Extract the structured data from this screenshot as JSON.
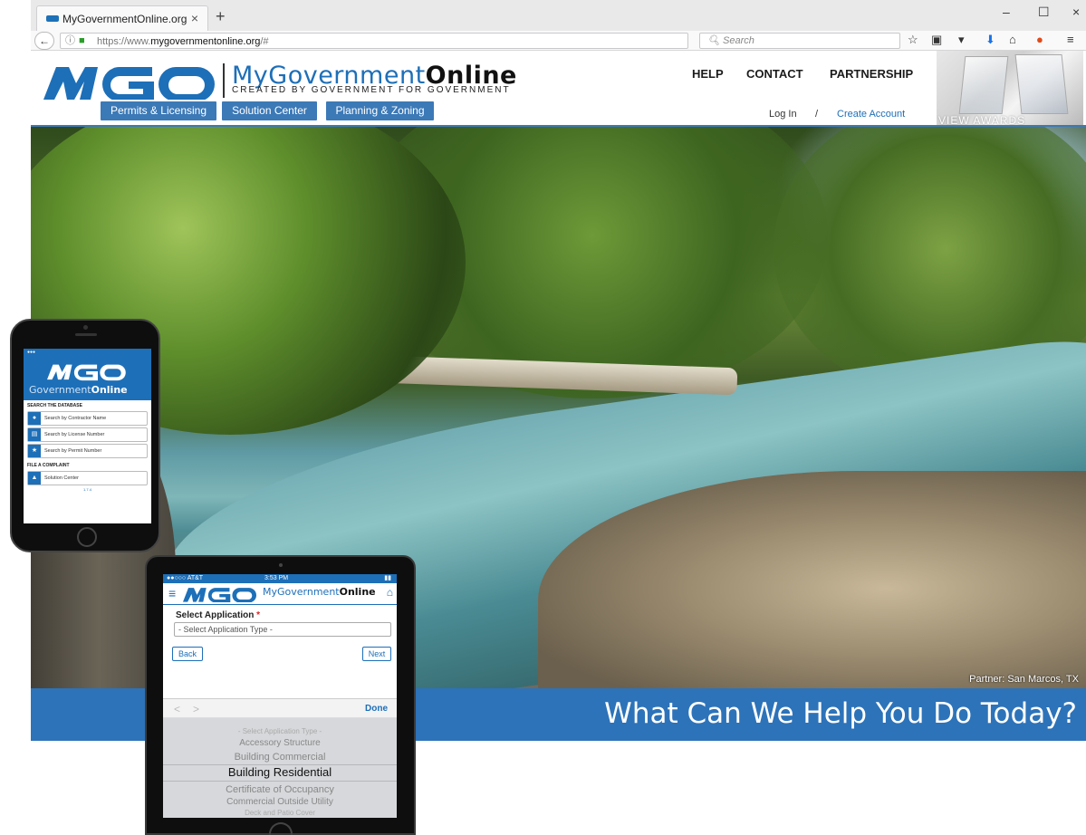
{
  "browser": {
    "tab_title": "MyGovernmentOnline.org",
    "tab_close": "×",
    "new_tab": "+",
    "url_prefix": "https://www.",
    "url_domain": "mygovernmentonline.org",
    "url_suffix": "/#",
    "search_placeholder": "Search",
    "win_min": "–",
    "win_max": "☐",
    "win_close": "×"
  },
  "site": {
    "logo_word_light": "MyGovernment",
    "logo_word_bold": "Online",
    "tagline": "CREATED BY GOVERNMENT FOR GOVERNMENT",
    "nav": [
      "HELP",
      "CONTACT",
      "PARTNERSHIP"
    ],
    "subnav": [
      "Permits & Licensing",
      "Solution Center",
      "Planning & Zoning"
    ],
    "login": "Log In",
    "separator": "/",
    "create_account": "Create Account",
    "awards_label": "VIEW AWARDS",
    "hero_credit": "Partner: San Marcos, TX",
    "headline": "What Can We Help You Do Today?"
  },
  "phone": {
    "gov_light": "Government",
    "gov_bold": "Online",
    "section1": "SEARCH THE DATABASE",
    "rows": [
      "Search by Contractor Name",
      "Search by License Number",
      "Search by Permit Number"
    ],
    "section2": "FILE A COMPLAINT",
    "solution": "Solution Center",
    "footer": "1.7.4"
  },
  "tablet": {
    "carrier": "●●○○○ AT&T",
    "time": "3:53 PM",
    "logo_light": "MyGovernment",
    "logo_bold": "Online",
    "label": "Select Application",
    "required": "*",
    "select_value": "- Select Application Type -",
    "back": "Back",
    "next": "Next",
    "done": "Done",
    "options": [
      "- Select Application Type -",
      "Accessory Structure",
      "Building Commercial",
      "Building Residential",
      "Certificate of Occupancy",
      "Commercial Outside Utility",
      "Deck and Patio Cover"
    ],
    "selected_index": 3
  },
  "colors": {
    "brand_blue": "#2d73b9",
    "nav_blue": "#3c79b7"
  }
}
